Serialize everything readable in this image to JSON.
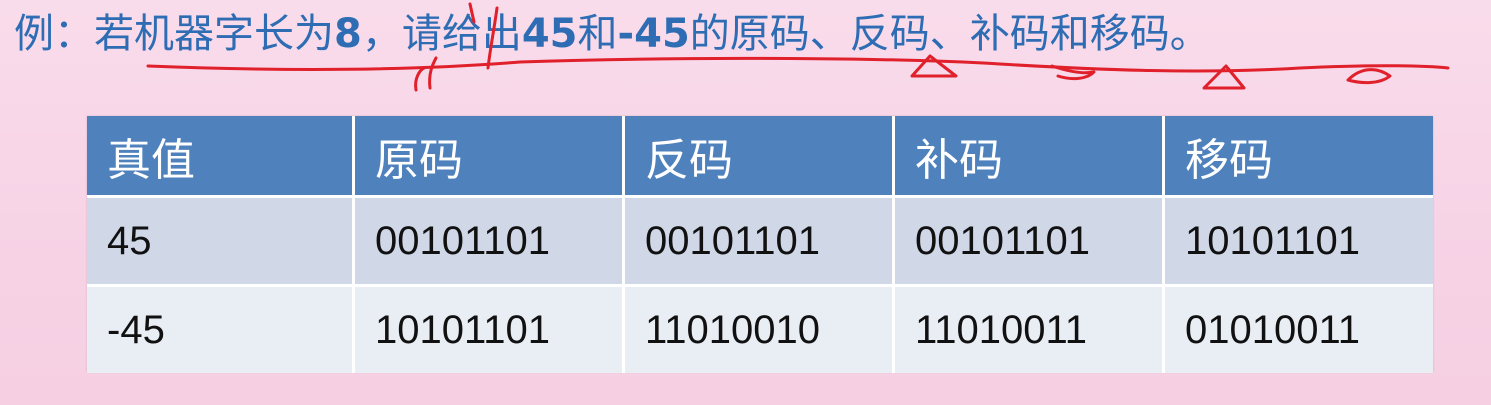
{
  "title": {
    "prefix": "例：若机器字长为",
    "word_length": "8",
    "comma": "，",
    "mid": "请给出",
    "pos_value": "45",
    "and": "和",
    "neg_value": "-45",
    "suffix": "的原码、反码、补码和移码。"
  },
  "table": {
    "headers": [
      "真值",
      "原码",
      "反码",
      "补码",
      "移码"
    ],
    "rows": [
      [
        "45",
        "00101101",
        "00101101",
        "00101101",
        "10101101"
      ],
      [
        "-45",
        "10101101",
        "11010010",
        "11010011",
        "01010011"
      ]
    ]
  },
  "colors": {
    "title_text": "#2e6db4",
    "header_bg": "#4f81bd",
    "row1_bg": "#d0d8e8",
    "row2_bg": "#e9edf4",
    "ink": "#e0202a"
  }
}
